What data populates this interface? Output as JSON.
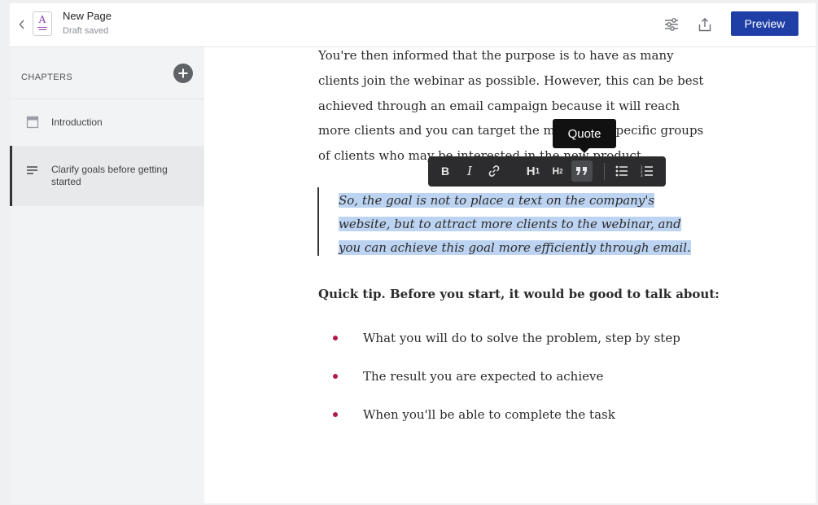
{
  "header": {
    "title": "New Page",
    "subtitle": "Draft saved",
    "doc_icon_letter": "A",
    "preview_label": "Preview"
  },
  "sidebar": {
    "chapters_label": "CHAPTERS",
    "items": [
      {
        "label": "Introduction",
        "icon": "panel-icon",
        "active": false
      },
      {
        "label": "Clarify goals before getting started",
        "icon": "text-lines-icon",
        "active": true
      }
    ]
  },
  "editor": {
    "paragraph": "You're then informed that the purpose is to have as many clients join the webinar as possible. However, this can be best achieved through an email campaign because it will reach more clients and you can target the mailing to specific groups of clients who may be interested in the new product.",
    "quote": "So, the goal is not to place a text on the company's website, but to attract more clients to the webinar, and you can achieve this goal more efficiently through email.",
    "tip": "Quick tip. Before you start, it would be good to talk about:",
    "bullets": [
      "What you will do to solve the problem, step by step",
      "The result you are expected to achieve",
      "When you'll be able to complete the task"
    ]
  },
  "toolbar": {
    "bold": "B",
    "italic": "I",
    "h1": "H",
    "h1_sub": "1",
    "h2": "H",
    "h2_sub": "2",
    "tooltip": "Quote"
  },
  "colors": {
    "primary": "#1f3fa6",
    "selection": "#bcd3f1",
    "bullet": "#b01a4a",
    "toolbar_bg": "#2c2c2e"
  }
}
